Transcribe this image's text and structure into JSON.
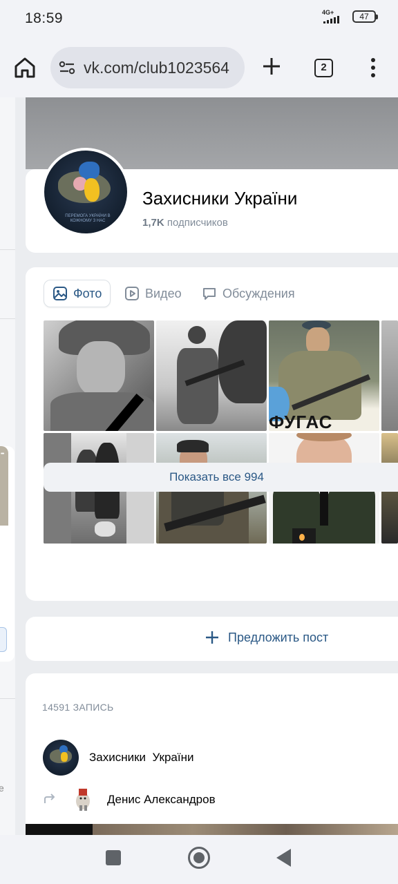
{
  "status_bar": {
    "time": "18:59",
    "network": "4G+",
    "battery": "47"
  },
  "browser": {
    "url": "vk.com/club1023564",
    "tab_count": "2"
  },
  "group": {
    "name": "Захисники України",
    "subscribers_count": "1,7K",
    "subscribers_label": "подписчиков",
    "avatar_caption": "ПЕРЕМОГА УКРАЇНИ В КОЖНОМУ З НАС"
  },
  "media_tabs": [
    {
      "label": "Фото",
      "icon": "photo-icon",
      "active": true
    },
    {
      "label": "Видео",
      "icon": "video-icon",
      "active": false
    },
    {
      "label": "Обсуждения",
      "icon": "discussion-icon",
      "active": false
    }
  ],
  "photos": [
    {
      "name": "photo-soldier-portrait-helmet"
    },
    {
      "name": "photo-soldier-with-rifle"
    },
    {
      "name": "photo-soldier-beret-camo"
    },
    {
      "name": "photo-couple-outdoor"
    },
    {
      "name": "photo-soldier-vest-rifle"
    },
    {
      "name": "photo-officer-uniform"
    }
  ],
  "photo_texts": {
    "fugas": "ФУГАС"
  },
  "show_all_label": "Показать все 994",
  "suggest_post_label": "Предложить пост",
  "feed": {
    "count_label": "14591 ЗАПИСЬ",
    "post_author": "Захисники  України",
    "repost_author": "Денис Александров"
  },
  "colors": {
    "accent": "#2a5885",
    "muted": "#818c99",
    "page_bg": "#ebedf0"
  }
}
